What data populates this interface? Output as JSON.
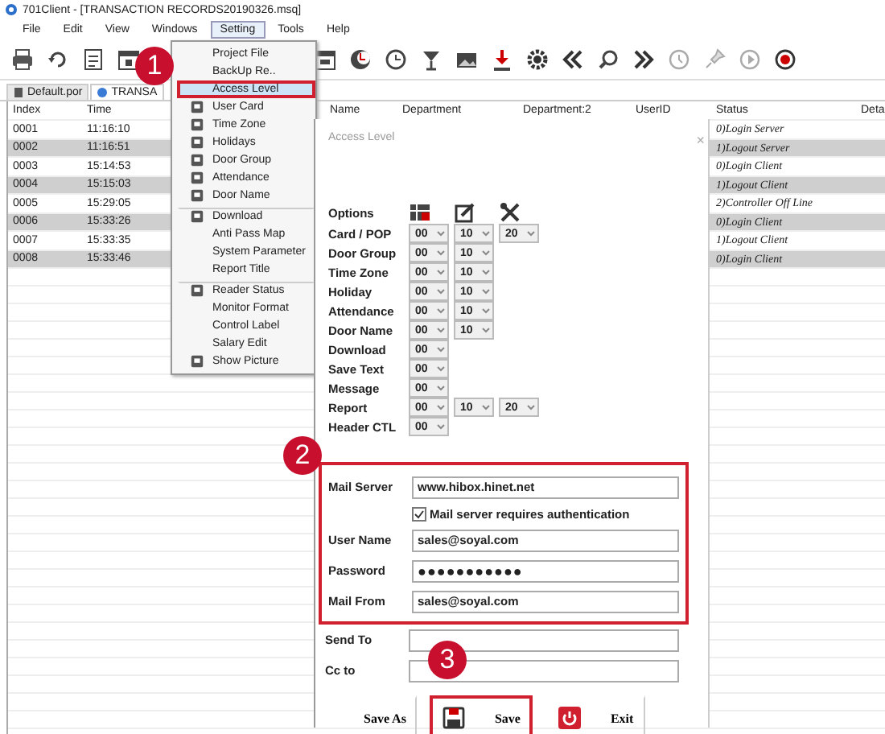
{
  "window": {
    "title": "701Client - [TRANSACTION RECORDS20190326.msq]"
  },
  "menu_bar": [
    {
      "label": "File",
      "selected": false
    },
    {
      "label": "Edit",
      "selected": false
    },
    {
      "label": "View",
      "selected": false
    },
    {
      "label": "Windows",
      "selected": false
    },
    {
      "label": "Setting",
      "selected": true
    },
    {
      "label": "Tools",
      "selected": false
    },
    {
      "label": "Help",
      "selected": false
    }
  ],
  "tabs": [
    {
      "label": "Default.por",
      "selected": false
    },
    {
      "label": "TRANSA",
      "selected": true
    }
  ],
  "table": {
    "columns": [
      "Index",
      "Time",
      "",
      "Name",
      "Department",
      "Department:2",
      "UserID",
      "Status",
      "Deta"
    ],
    "rows": [
      {
        "index": "0001",
        "time": "11:16:10",
        "status": "0)Login  Server",
        "selected": false
      },
      {
        "index": "0002",
        "time": "11:16:51",
        "status": "1)Logout  Server",
        "selected": true
      },
      {
        "index": "0003",
        "time": "15:14:53",
        "status": "0)Login  Client",
        "selected": false
      },
      {
        "index": "0004",
        "time": "15:15:03",
        "status": "1)Logout  Client",
        "selected": true
      },
      {
        "index": "0005",
        "time": "15:29:05",
        "status": "2)Controller Off Line",
        "selected": false
      },
      {
        "index": "0006",
        "time": "15:33:26",
        "status": "0)Login  Client",
        "selected": true
      },
      {
        "index": "0007",
        "time": "15:33:35",
        "status": "1)Logout  Client",
        "selected": false
      },
      {
        "index": "0008",
        "time": "15:33:46",
        "status": "0)Login  Client",
        "selected": true
      }
    ]
  },
  "setting_menu": [
    {
      "label": "Project File",
      "icon": false,
      "separator_before": false,
      "selected": false,
      "marked": false
    },
    {
      "label": "BackUp Re..",
      "icon": false,
      "separator_before": false,
      "selected": false,
      "marked": false
    },
    {
      "label": "Access Level",
      "icon": false,
      "separator_before": false,
      "selected": true,
      "marked": true
    },
    {
      "label": "User Card",
      "icon": true,
      "separator_before": false,
      "selected": false,
      "marked": false
    },
    {
      "label": "Time Zone",
      "icon": true,
      "separator_before": false,
      "selected": false,
      "marked": false
    },
    {
      "label": "Holidays",
      "icon": true,
      "separator_before": false,
      "selected": false,
      "marked": false
    },
    {
      "label": "Door Group",
      "icon": true,
      "separator_before": false,
      "selected": false,
      "marked": false
    },
    {
      "label": "Attendance",
      "icon": true,
      "separator_before": false,
      "selected": false,
      "marked": false
    },
    {
      "label": "Door Name",
      "icon": true,
      "separator_before": false,
      "selected": false,
      "marked": false
    },
    {
      "label": "Download",
      "icon": true,
      "separator_before": true,
      "selected": false,
      "marked": false
    },
    {
      "label": "Anti Pass Map",
      "icon": false,
      "separator_before": false,
      "selected": false,
      "marked": false
    },
    {
      "label": "System Parameter",
      "icon": false,
      "separator_before": false,
      "selected": false,
      "marked": false
    },
    {
      "label": "Report Title",
      "icon": false,
      "separator_before": false,
      "selected": false,
      "marked": false
    },
    {
      "label": "Reader Status",
      "icon": true,
      "separator_before": true,
      "selected": false,
      "marked": false
    },
    {
      "label": "Monitor Format",
      "icon": false,
      "separator_before": false,
      "selected": false,
      "marked": false
    },
    {
      "label": "Control Label",
      "icon": false,
      "separator_before": false,
      "selected": false,
      "marked": false
    },
    {
      "label": "Salary Edit",
      "icon": false,
      "separator_before": false,
      "selected": false,
      "marked": false
    },
    {
      "label": "Show Picture",
      "icon": true,
      "separator_before": false,
      "selected": false,
      "marked": false
    }
  ],
  "dialog": {
    "title": "Access Level",
    "close": "×",
    "options_label": "Options",
    "settings": [
      {
        "label": "Card / POP",
        "values": [
          "00",
          "10",
          "20"
        ]
      },
      {
        "label": "Door Group",
        "values": [
          "00",
          "10"
        ]
      },
      {
        "label": "Time Zone",
        "values": [
          "00",
          "10"
        ]
      },
      {
        "label": "Holiday",
        "values": [
          "00",
          "10"
        ]
      },
      {
        "label": "Attendance",
        "values": [
          "00",
          "10"
        ]
      },
      {
        "label": "Door Name",
        "values": [
          "00",
          "10"
        ]
      },
      {
        "label": "Download",
        "values": [
          "00"
        ]
      },
      {
        "label": "Save Text",
        "values": [
          "00"
        ]
      },
      {
        "label": "Message",
        "values": [
          "00"
        ]
      },
      {
        "label": "Report",
        "values": [
          "00",
          "10",
          "20"
        ]
      },
      {
        "label": "Header CTL",
        "values": [
          "00"
        ]
      }
    ],
    "mail_settings": {
      "marked": true,
      "fields": [
        {
          "kind": "text",
          "label": "Mail Server",
          "value": "www.hibox.hinet.net"
        },
        {
          "kind": "checkbox",
          "label": "Mail server requires authentication",
          "checked": true
        },
        {
          "kind": "text",
          "label": "User Name",
          "value": "sales@soyal.com"
        },
        {
          "kind": "password",
          "label": "Password",
          "value": "●●●●●●●●●●●"
        },
        {
          "kind": "text",
          "label": "Mail From",
          "value": "sales@soyal.com"
        }
      ]
    },
    "recipients": [
      {
        "label": "Send To"
      },
      {
        "label": "Cc to"
      }
    ],
    "buttons": [
      {
        "label": "Save As",
        "kind": "plain",
        "marked": false
      },
      {
        "label": "Save",
        "kind": "save",
        "marked": true
      },
      {
        "label": "Exit",
        "kind": "exit",
        "marked": false
      }
    ]
  },
  "callouts": [
    {
      "number": "1"
    },
    {
      "number": "2"
    },
    {
      "number": "3"
    }
  ]
}
